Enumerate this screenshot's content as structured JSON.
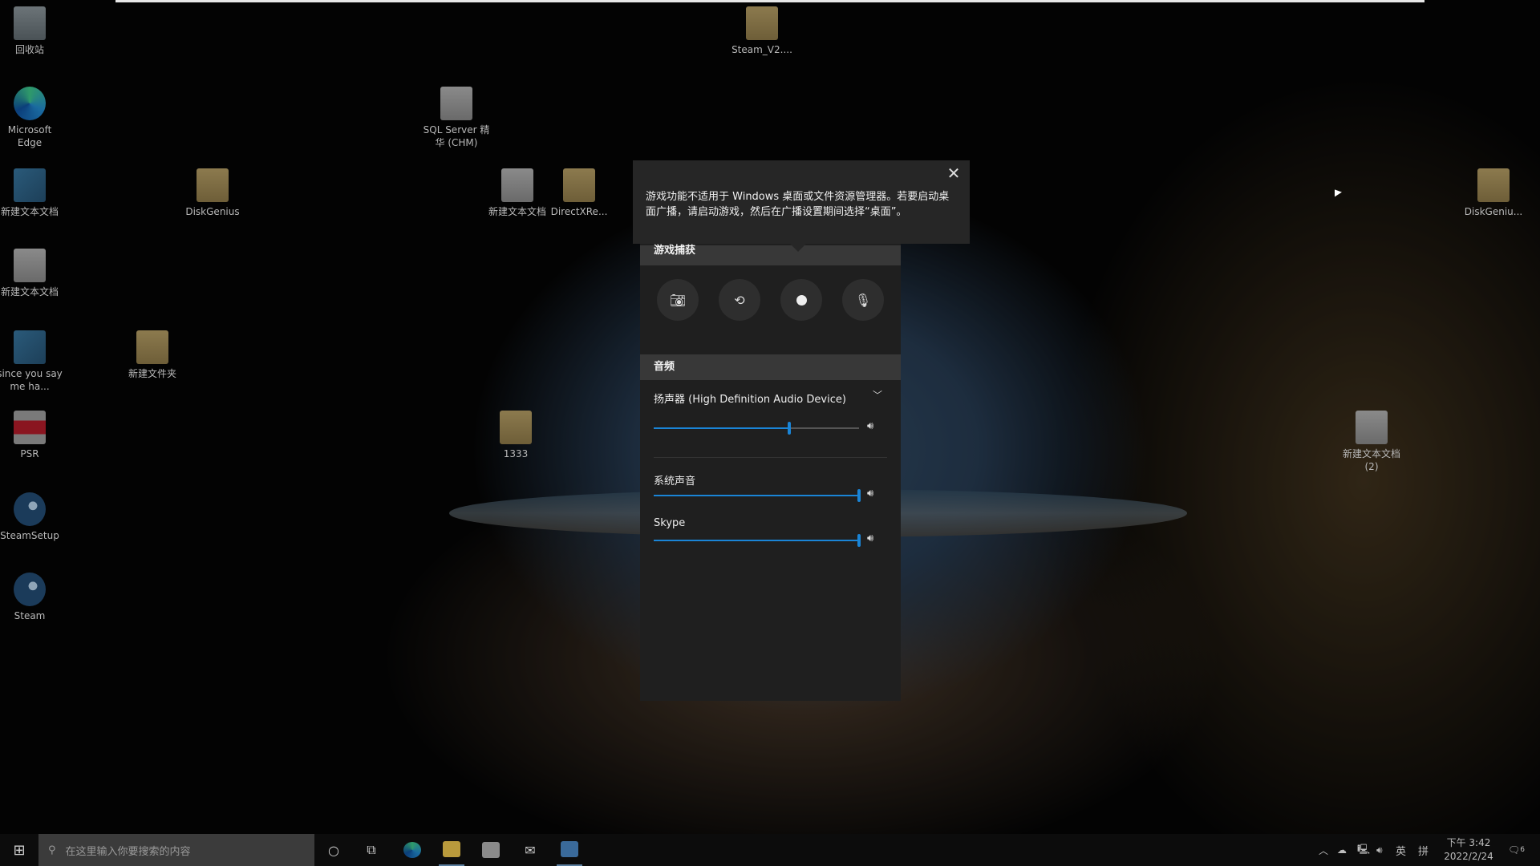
{
  "desktop": {
    "icons": [
      {
        "label": "回收站",
        "kind": "bin"
      },
      {
        "label": "Microsoft Edge",
        "kind": "edge"
      },
      {
        "label": "新建文本文档",
        "kind": "reg"
      },
      {
        "label": "新建文本文档",
        "kind": "doc"
      },
      {
        "label": "since you say me ha...",
        "kind": "reg"
      },
      {
        "label": "PSR",
        "kind": "pdf"
      },
      {
        "label": "SteamSetup",
        "kind": "steam"
      },
      {
        "label": "Steam",
        "kind": "steam"
      },
      {
        "label": "DiskGenius",
        "kind": "folder"
      },
      {
        "label": "新建文件夹",
        "kind": "folder"
      },
      {
        "label": "SQL Server 精华 (CHM)",
        "kind": "doc"
      },
      {
        "label": "新建文本文档",
        "kind": "doc"
      },
      {
        "label": "DirectXRe...",
        "kind": "folder"
      },
      {
        "label": "Steam_V2....",
        "kind": "folder"
      },
      {
        "label": "DiskGeniu...",
        "kind": "folder"
      },
      {
        "label": "1333",
        "kind": "folder"
      },
      {
        "label": "新建文本文档 (2)",
        "kind": "doc"
      }
    ]
  },
  "gamebar": {
    "tooltip": {
      "text": "游戏功能不适用于 Windows 桌面或文件资源管理器。若要启动桌面广播，请启动游戏，然后在广播设置期间选择“桌面”。",
      "close_icon": "close-icon"
    },
    "capture": {
      "title": "游戏捕获",
      "buttons": [
        "camera-icon",
        "record-last-icon",
        "record-icon",
        "mic-off-icon"
      ]
    },
    "audio": {
      "title": "音频",
      "device": "扬声器 (High Definition Audio Device)",
      "master_volume_percent": 66,
      "apps": [
        {
          "name": "系统声音",
          "volume_percent": 100
        },
        {
          "name": "Skype",
          "volume_percent": 100
        }
      ]
    },
    "accent": "#1a84d6"
  },
  "taskbar": {
    "search_placeholder": "在这里输入你要搜索的内容",
    "time": "下午 3:42",
    "date": "2022/2/24",
    "ime_lang": "英",
    "ime_mode": "拼",
    "notifications": "6"
  }
}
